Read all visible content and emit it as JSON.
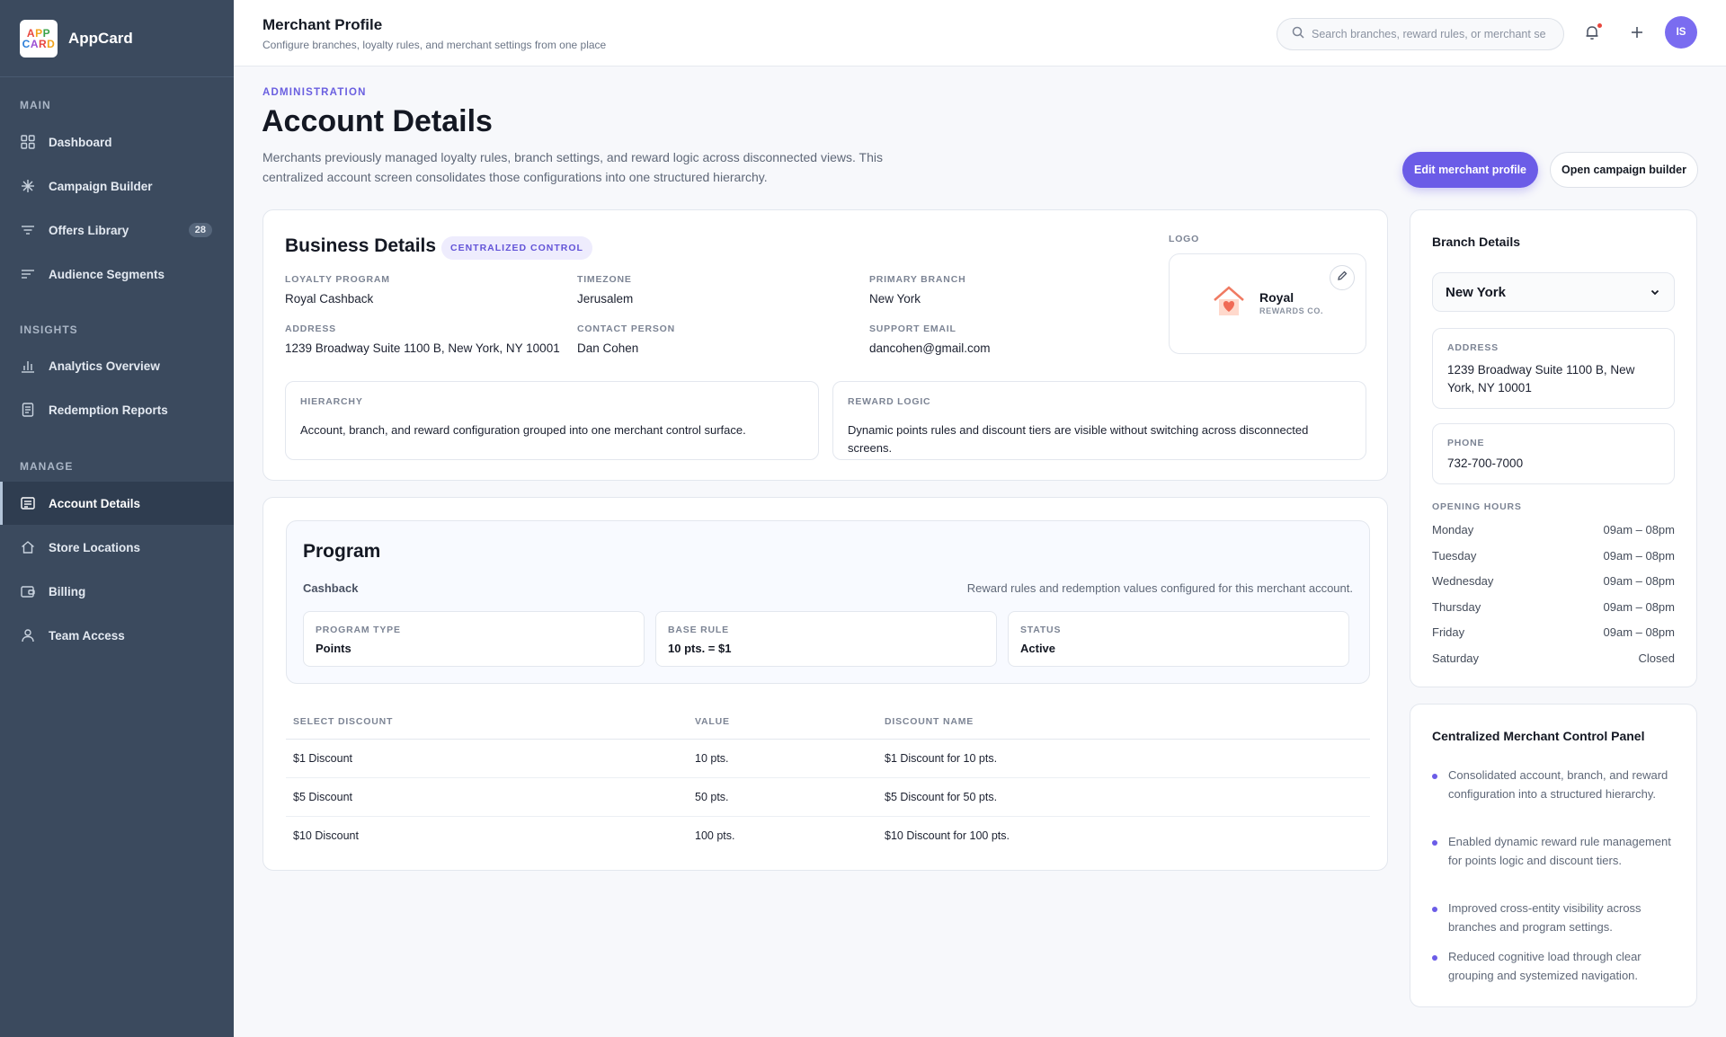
{
  "app": {
    "name": "AppCard",
    "logo_line1": [
      "A",
      "P",
      "P"
    ],
    "logo_line2": [
      "C",
      "A",
      "R",
      "D"
    ]
  },
  "sidebar": {
    "sections": [
      {
        "label": "MAIN"
      },
      {
        "label": "INSIGHTS"
      },
      {
        "label": "MANAGE"
      }
    ],
    "items": [
      {
        "label": "Dashboard",
        "icon": "grid-icon"
      },
      {
        "label": "Campaign Builder",
        "icon": "sparkle-icon"
      },
      {
        "label": "Offers Library",
        "icon": "filter-icon",
        "badge": "28"
      },
      {
        "label": "Audience Segments",
        "icon": "lines-icon"
      },
      {
        "label": "Analytics Overview",
        "icon": "bar-chart-icon"
      },
      {
        "label": "Redemption Reports",
        "icon": "report-icon"
      },
      {
        "label": "Account Details",
        "icon": "account-icon",
        "active": true
      },
      {
        "label": "Store Locations",
        "icon": "home-icon"
      },
      {
        "label": "Billing",
        "icon": "wallet-icon"
      },
      {
        "label": "Team Access",
        "icon": "user-icon"
      }
    ]
  },
  "topbar": {
    "title": "Merchant Profile",
    "subtitle": "Configure branches, loyalty rules, and merchant settings from one place",
    "search_placeholder": "Search branches, reward rules, or merchant se",
    "avatar": "IS"
  },
  "header": {
    "eyebrow": "ADMINISTRATION",
    "title": "Account Details",
    "description": "Merchants previously managed loyalty rules, branch settings, and reward logic across disconnected views. This centralized account screen consolidates those configurations into one structured hierarchy.",
    "primary_button": "Edit merchant profile",
    "secondary_button": "Open campaign builder"
  },
  "business": {
    "title": "Business Details",
    "pill": "CENTRALIZED CONTROL",
    "logo_label": "LOGO",
    "logo_name": "Royal",
    "logo_tagline": "REWARDS CO.",
    "fields": [
      {
        "label": "LOYALTY PROGRAM",
        "value": "Royal Cashback"
      },
      {
        "label": "TIMEZONE",
        "value": "Jerusalem"
      },
      {
        "label": "PRIMARY BRANCH",
        "value": "New York"
      },
      {
        "label": "ADDRESS",
        "value": "1239 Broadway Suite 1100 B, New York, NY 10001"
      },
      {
        "label": "CONTACT PERSON",
        "value": "Dan Cohen"
      },
      {
        "label": "SUPPORT EMAIL",
        "value": "dancohen@gmail.com"
      }
    ],
    "hierarchy": {
      "label": "HIERARCHY",
      "text": "Account, branch, and reward configuration grouped into one merchant control surface."
    },
    "reward_logic": {
      "label": "REWARD LOGIC",
      "text": "Dynamic points rules and discount tiers are visible without switching across disconnected screens."
    }
  },
  "program": {
    "title": "Program",
    "subtitle": "Cashback",
    "note": "Reward rules and redemption values configured for this merchant account.",
    "stats": [
      {
        "label": "PROGRAM TYPE",
        "value": "Points"
      },
      {
        "label": "BASE RULE",
        "value": "10 pts. = $1"
      },
      {
        "label": "STATUS",
        "value": "Active"
      }
    ],
    "table": {
      "headers": [
        "SELECT DISCOUNT",
        "VALUE",
        "DISCOUNT NAME"
      ],
      "rows": [
        [
          "$1 Discount",
          "10 pts.",
          "$1 Discount for 10 pts."
        ],
        [
          "$5 Discount",
          "50 pts.",
          "$5 Discount for 50 pts."
        ],
        [
          "$10 Discount",
          "100 pts.",
          "$10 Discount for 100 pts."
        ]
      ]
    }
  },
  "branch": {
    "title": "Branch Details",
    "selected": "New York",
    "address_label": "ADDRESS",
    "address": "1239 Broadway Suite 1100 B, New York, NY 10001",
    "phone_label": "PHONE",
    "phone": "732-700-7000",
    "hours_label": "OPENING HOURS",
    "hours": [
      {
        "day": "Monday",
        "time": "09am – 08pm"
      },
      {
        "day": "Tuesday",
        "time": "09am – 08pm"
      },
      {
        "day": "Wednesday",
        "time": "09am – 08pm"
      },
      {
        "day": "Thursday",
        "time": "09am – 08pm"
      },
      {
        "day": "Friday",
        "time": "09am – 08pm"
      },
      {
        "day": "Saturday",
        "time": "Closed"
      }
    ]
  },
  "panel": {
    "title": "Centralized Merchant Control Panel",
    "bullets": [
      "Consolidated account, branch, and reward configuration into a structured hierarchy.",
      "Enabled dynamic reward rule management for points logic and discount tiers.",
      "Improved cross-entity visibility across branches and program settings.",
      "Reduced cognitive load through clear grouping and systemized navigation."
    ]
  },
  "colors": {
    "accent": "#6b5ce7",
    "sidebar": "#3b4a5e",
    "notification": "#e8473e"
  }
}
